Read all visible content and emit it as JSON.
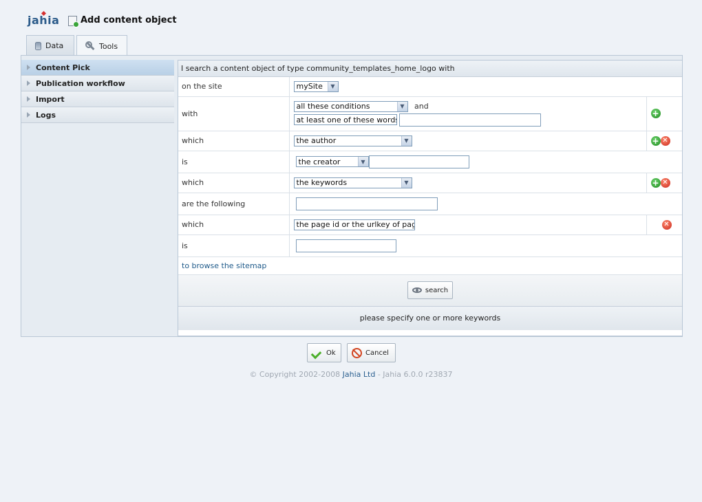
{
  "header": {
    "logo": "jahia",
    "title": "Add content object"
  },
  "tabs": [
    {
      "label": "Data"
    },
    {
      "label": "Tools"
    }
  ],
  "sidebar": {
    "items": [
      {
        "label": "Content Pick"
      },
      {
        "label": "Publication workflow"
      },
      {
        "label": "Import"
      },
      {
        "label": "Logs"
      }
    ]
  },
  "form": {
    "header": "I search a content object of type community_templates_home_logo with",
    "rows": {
      "site": {
        "label": "on the site",
        "value": "mySite"
      },
      "with": {
        "label": "with",
        "conditions": "all these conditions",
        "and": "and",
        "mode": "at least one of these words",
        "text": ""
      },
      "which1": {
        "label": "which",
        "value": "the author"
      },
      "is1": {
        "label": "is",
        "value": "the creator",
        "text": ""
      },
      "which2": {
        "label": "which",
        "value": "the keywords"
      },
      "following": {
        "label": "are the following",
        "text": ""
      },
      "which3": {
        "label": "which",
        "value": "the page id or the urlkey of page"
      },
      "is2": {
        "label": "is",
        "text": ""
      }
    },
    "browse_link": "to browse the sitemap",
    "search_button": "search",
    "message": "please specify one or more keywords"
  },
  "footer": {
    "ok": "Ok",
    "cancel": "Cancel",
    "copyright_prefix": "© Copyright 2002-2008 ",
    "company": "Jahia Ltd",
    "copyright_suffix": " - Jahia 6.0.0 r23837"
  }
}
